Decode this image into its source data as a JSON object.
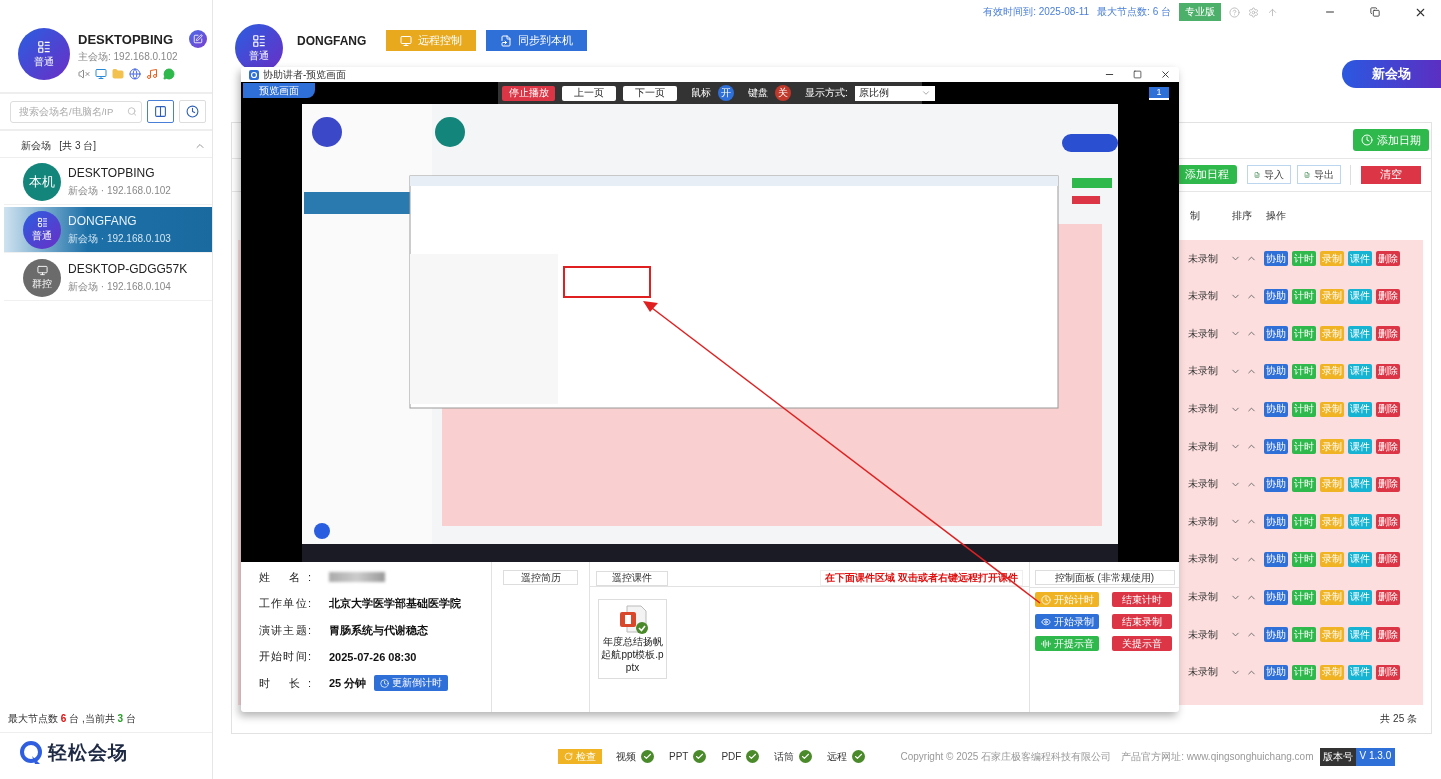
{
  "sidebar": {
    "profile": {
      "name": "DESKTOPBING",
      "badge": "普通",
      "subtitle": "主会场: 192.168.0.102"
    },
    "search": {
      "placeholder": "搜索会场名/电脑名/IP"
    },
    "group": {
      "title": "新会场",
      "count": "[共 3 台]",
      "expanded": true
    },
    "devices": [
      {
        "name": "DESKTOPBING",
        "info": "新会场 · 192.168.0.102",
        "badge": "本机",
        "kind": "local",
        "selected": false
      },
      {
        "name": "DONGFANG",
        "info": "新会场 · 192.168.0.103",
        "badge": "普通",
        "kind": "normal",
        "selected": true
      },
      {
        "name": "DESKTOP-GDGG57K",
        "info": "新会场 · 192.168.0.104",
        "badge": "群控",
        "kind": "group",
        "selected": false
      }
    ],
    "node_status": [
      {
        "kind": "plain",
        "text": "最大节点数 "
      },
      {
        "kind": "max",
        "text": "6"
      },
      {
        "kind": "plain",
        "text": " 台 ,当前共 "
      },
      {
        "kind": "current",
        "text": "3"
      },
      {
        "kind": "plain",
        "text": " 台"
      }
    ],
    "logo": "轻松会场"
  },
  "topbar": {
    "expiry": "有效时间到: 2025-08-11",
    "max_nodes": "最大节点数: 6 台",
    "edition": "专业版"
  },
  "header": {
    "name": "DONGFANG",
    "badge": "普通",
    "buttons": [
      {
        "label": "远程控制",
        "kind": "remote"
      },
      {
        "label": "同步到本机",
        "kind": "sync"
      }
    ],
    "new_venue": "新会场"
  },
  "schedule": {
    "add_date": "添加日期",
    "toolbar": [
      {
        "label": "添加日程",
        "kind": "add"
      },
      {
        "label": "导入",
        "kind": "import"
      },
      {
        "label": "导出",
        "kind": "export"
      },
      {
        "label": "清空",
        "kind": "clear"
      }
    ],
    "columns": [
      "制",
      "排序",
      "操作"
    ],
    "rows": [
      {
        "status": "未录制",
        "actions": [
          "协助",
          "计时",
          "录制",
          "课件",
          "删除"
        ]
      },
      {
        "status": "未录制",
        "actions": [
          "协助",
          "计时",
          "录制",
          "课件",
          "删除"
        ]
      },
      {
        "status": "未录制",
        "actions": [
          "协助",
          "计时",
          "录制",
          "课件",
          "删除"
        ]
      },
      {
        "status": "未录制",
        "actions": [
          "协助",
          "计时",
          "录制",
          "课件",
          "删除"
        ]
      },
      {
        "status": "未录制",
        "actions": [
          "协助",
          "计时",
          "录制",
          "课件",
          "删除"
        ]
      },
      {
        "status": "未录制",
        "actions": [
          "协助",
          "计时",
          "录制",
          "课件",
          "删除"
        ]
      },
      {
        "status": "未录制",
        "actions": [
          "协助",
          "计时",
          "录制",
          "课件",
          "删除"
        ]
      },
      {
        "status": "未录制",
        "actions": [
          "协助",
          "计时",
          "录制",
          "课件",
          "删除"
        ]
      },
      {
        "status": "未录制",
        "actions": [
          "协助",
          "计时",
          "录制",
          "课件",
          "删除"
        ]
      },
      {
        "status": "未录制",
        "actions": [
          "协助",
          "计时",
          "录制",
          "课件",
          "删除"
        ]
      },
      {
        "status": "未录制",
        "actions": [
          "协助",
          "计时",
          "录制",
          "课件",
          "删除"
        ]
      },
      {
        "status": "未录制",
        "actions": [
          "协助",
          "计时",
          "录制",
          "课件",
          "删除"
        ]
      }
    ],
    "total": "共 25 条"
  },
  "dialog": {
    "title": "协助讲者-预览画面",
    "tab": "预览画面",
    "controls": {
      "stop": "停止播放",
      "prev": "上一页",
      "next": "下一页",
      "mouse": {
        "label": "鼠标",
        "state": "开",
        "on": true
      },
      "keyboard": {
        "label": "键盘",
        "state": "关",
        "on": false
      },
      "display_label": "显示方式:",
      "display_value": "原比例"
    },
    "page_badge": "1",
    "speaker": [
      {
        "label": "姓 名:",
        "redacted": true
      },
      {
        "label": "工作单位:",
        "value": "北京大学医学部基础医学院"
      },
      {
        "label": "演讲主题:",
        "value": "胃肠系统与代谢稳态"
      },
      {
        "label": "开始时间:",
        "value": "2025-07-26 08:30"
      },
      {
        "label": "时 长:",
        "value": "25 分钟",
        "button": "更新倒计时"
      }
    ],
    "resume": {
      "title": "遥控简历"
    },
    "courseware": {
      "title": "遥控课件",
      "hint": "在下面课件区域 双击或者右键远程打开课件",
      "files": [
        {
          "name": "年度总结扬帆起航ppt模板.pptx",
          "synced": true
        }
      ]
    },
    "control_panel": {
      "title": "控制面板 (非常规使用)",
      "buttons": [
        {
          "label": "开始计时",
          "kind": "timer"
        },
        {
          "label": "结束计时",
          "kind": "stop"
        },
        {
          "label": "开始录制",
          "kind": "record"
        },
        {
          "label": "结束录制",
          "kind": "stop"
        },
        {
          "label": "开提示音",
          "kind": "sound"
        },
        {
          "label": "关提示音",
          "kind": "stop"
        }
      ]
    }
  },
  "footer": {
    "check_button": "检查",
    "checks": [
      {
        "label": "视频",
        "ok": true
      },
      {
        "label": "PPT",
        "ok": true
      },
      {
        "label": "PDF",
        "ok": true
      },
      {
        "label": "话筒",
        "ok": true
      },
      {
        "label": "远程",
        "ok": true
      }
    ],
    "copyright": "Copyright © 2025 石家庄极客编程科技有限公司",
    "website": "产品官方网址: www.qingsonghuichang.com",
    "version_label": "版本号",
    "version": "V 1.3.0"
  }
}
